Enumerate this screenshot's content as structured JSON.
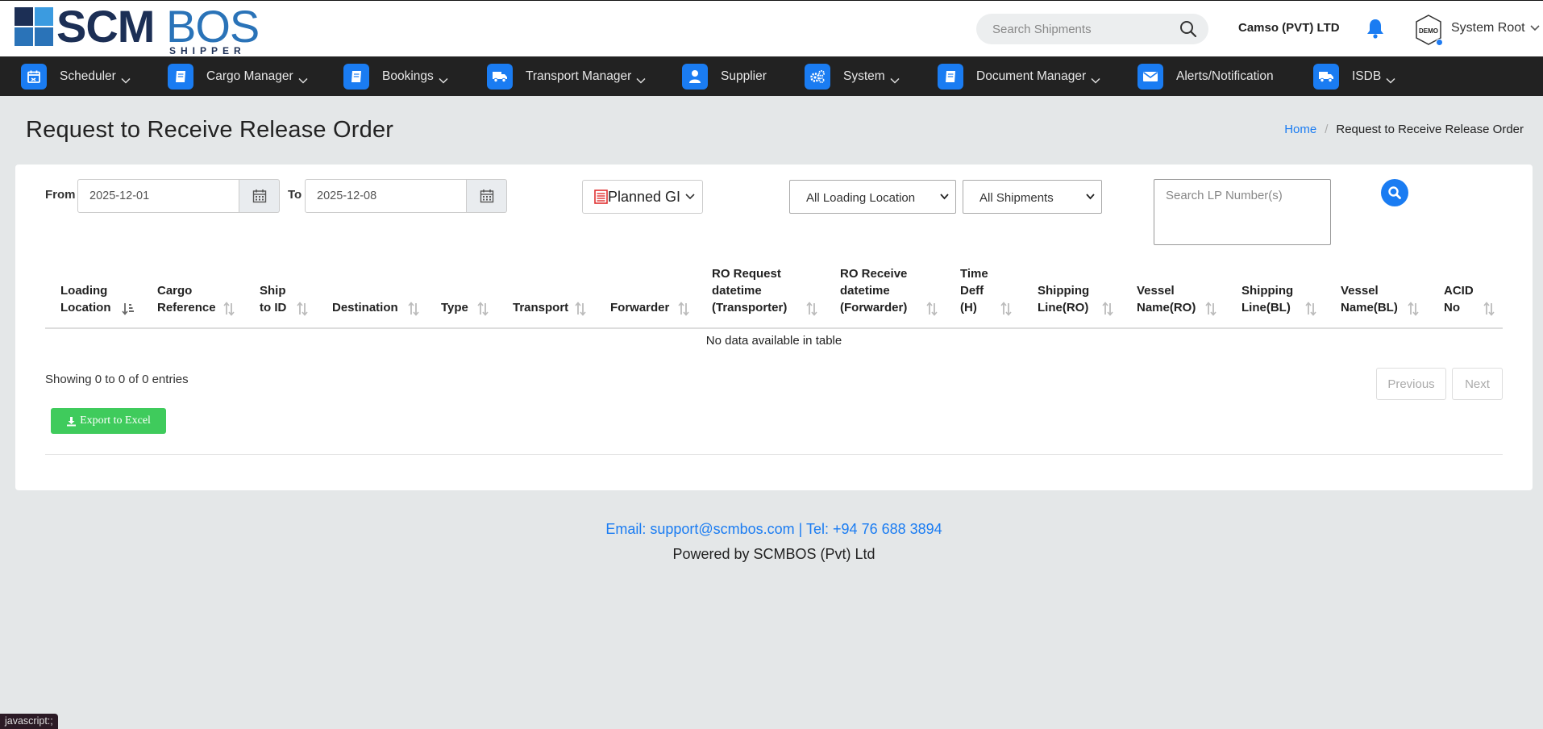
{
  "logo": {
    "scm": "SCM",
    "bos": "BOS",
    "tagline": "SHIPPER"
  },
  "header": {
    "search_placeholder": "Search Shipments",
    "company": "Camso (PVT) LTD",
    "avatar_text": "DEMO",
    "user": "System Root"
  },
  "nav": [
    {
      "label": "Scheduler",
      "icon": "calendar-icon",
      "dropdown": true
    },
    {
      "label": "Cargo Manager",
      "icon": "book-icon",
      "dropdown": true
    },
    {
      "label": "Bookings",
      "icon": "book-icon",
      "dropdown": true
    },
    {
      "label": "Transport Manager",
      "icon": "truck-icon",
      "dropdown": true
    },
    {
      "label": "Supplier",
      "icon": "user-icon",
      "dropdown": false
    },
    {
      "label": "System",
      "icon": "gears-icon",
      "dropdown": true
    },
    {
      "label": "Document Manager",
      "icon": "book-icon",
      "dropdown": true
    },
    {
      "label": "Alerts/Notification",
      "icon": "envelope-icon",
      "dropdown": false
    },
    {
      "label": "ISDB",
      "icon": "truck-icon",
      "dropdown": true
    }
  ],
  "page": {
    "title": "Request to Receive Release Order",
    "breadcrumb_home": "Home",
    "breadcrumb_current": "Request to Receive Release Order"
  },
  "filters": {
    "from_label": "From",
    "from_value": "2025-12-01",
    "to_label": "To",
    "to_value": "2025-12-08",
    "planned_label": "Planned GI",
    "location_selected": "All Loading Location",
    "shipments_selected": "All Shipments",
    "lp_placeholder": "Search LP Number(s)"
  },
  "table": {
    "columns": [
      "Loading\nLocation",
      "Cargo\nReference",
      "Ship\nto ID",
      "Destination",
      "Type",
      "Transport",
      "Forwarder",
      "RO Request\ndatetime\n(Transporter)",
      "RO Receive\ndatetime\n(Forwarder)",
      "Time\nDeff\n(H)",
      "Shipping\nLine(RO)",
      "Vessel\nName(RO)",
      "Shipping\nLine(BL)",
      "Vessel\nName(BL)",
      "ACID\nNo"
    ],
    "empty_text": "No data available in table",
    "info": "Showing 0 to 0 of 0 entries",
    "previous": "Previous",
    "next": "Next",
    "export": "Export to Excel"
  },
  "footer": {
    "contact": "Email: support@scmbos.com | Tel: +94 76 688 3894",
    "powered": "Powered by SCMBOS (Pvt) Ltd"
  },
  "status_bar": "javascript:;",
  "colors": {
    "accent": "#1a7cf2",
    "nav_bg": "#222222",
    "export": "#3fcb5c",
    "page_bg": "#e4e7e8"
  }
}
